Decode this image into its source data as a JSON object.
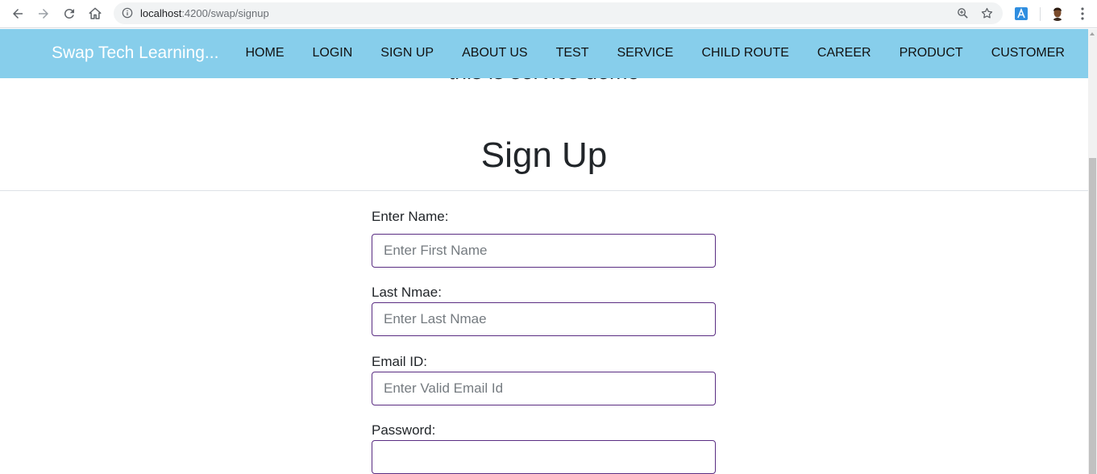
{
  "browser": {
    "url_host": "localhost",
    "url_path": ":4200/swap/signup"
  },
  "navbar": {
    "brand": "Swap Tech Learning...",
    "links": [
      "HOME",
      "LOGIN",
      "SIGN UP",
      "ABOUT US",
      "TEST",
      "SERVICE",
      "CHILD ROUTE",
      "CAREER",
      "PRODUCT",
      "CUSTOMER"
    ]
  },
  "page": {
    "service_text": "this is service demo",
    "title": "Sign Up"
  },
  "form": {
    "name_label": "Enter Name:",
    "name_placeholder": "Enter First Name",
    "last_label": "Last Nmae:",
    "last_placeholder": "Enter Last Nmae",
    "email_label": "Email ID:",
    "email_placeholder": "Enter Valid Email Id",
    "password_label": "Password:",
    "password_placeholder": ""
  },
  "colors": {
    "navbar_bg": "#87ceeb",
    "input_border": "#5a2d82"
  }
}
